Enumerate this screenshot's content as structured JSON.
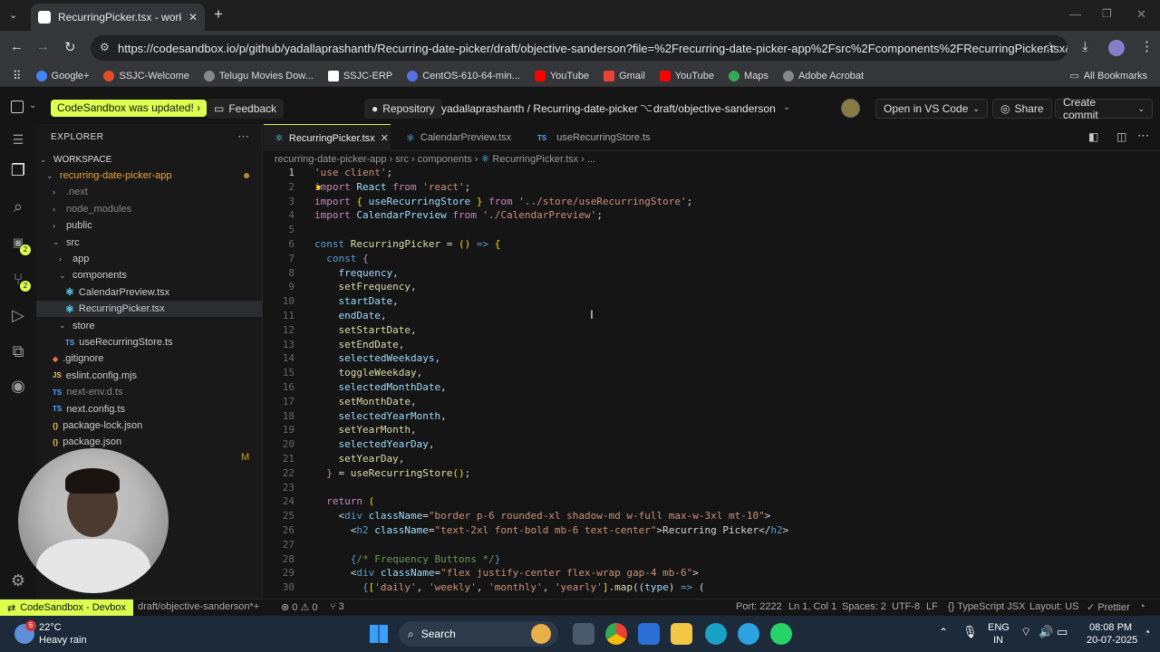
{
  "browser": {
    "tab_title": "RecurringPicker.tsx - workspace",
    "url": "https://codesandbox.io/p/github/yadallaprashanth/Recurring-date-picker/draft/objective-sanderson?file=%2Frecurring-date-picker-app%2Fsrc%2Fcomponents%2FRecurringPicker.tsx&workspace...",
    "bookmarks": [
      "Google+",
      "SSJC-Welcome",
      "Telugu Movies Dow...",
      "SSJC-ERP",
      "CentOS-610-64-min...",
      "YouTube",
      "Gmail",
      "YouTube",
      "Maps",
      "Adobe Acrobat"
    ],
    "all_bookmarks": "All Bookmarks",
    "bookmark_colors": [
      "#4285f4",
      "#e34c26",
      "#888888",
      "#ffffff",
      "#5b6ee1",
      "#ff0000",
      "#ea4335",
      "#ff0000",
      "#34a853",
      "#888888"
    ]
  },
  "topbar": {
    "update_notice": "CodeSandbox was updated!",
    "feedback": "Feedback",
    "repository": "Repository",
    "repo_path": "yadallaprashanth / Recurring-date-picker",
    "branch": "draft/objective-sanderson",
    "open_vscode": "Open in VS Code",
    "share": "Share",
    "create_commit": "Create commit"
  },
  "explorer": {
    "title": "EXPLORER",
    "workspace": "WORKSPACE",
    "items": [
      {
        "label": "recurring-date-picker-app",
        "kind": "folder-open",
        "indent": 1,
        "color": "#e8a33d",
        "dot": true
      },
      {
        "label": ".next",
        "kind": "folder",
        "indent": 2,
        "color": "#888888"
      },
      {
        "label": "node_modules",
        "kind": "folder",
        "indent": 2,
        "color": "#888888"
      },
      {
        "label": "public",
        "kind": "folder",
        "indent": 2,
        "color": "#cccccc"
      },
      {
        "label": "src",
        "kind": "folder-open",
        "indent": 2,
        "color": "#cccccc"
      },
      {
        "label": "app",
        "kind": "folder",
        "indent": 3,
        "color": "#cccccc"
      },
      {
        "label": "components",
        "kind": "folder-open",
        "indent": 3,
        "color": "#cccccc"
      },
      {
        "label": "CalendarPreview.tsx",
        "kind": "react",
        "indent": 4,
        "color": "#cccccc"
      },
      {
        "label": "RecurringPicker.tsx",
        "kind": "react",
        "indent": 4,
        "color": "#cccccc",
        "selected": true
      },
      {
        "label": "store",
        "kind": "folder-open",
        "indent": 3,
        "color": "#cccccc"
      },
      {
        "label": "useRecurringStore.ts",
        "kind": "ts",
        "indent": 4,
        "color": "#cccccc"
      },
      {
        "label": ".gitignore",
        "kind": "git",
        "indent": 2,
        "color": "#cccccc"
      },
      {
        "label": "eslint.config.mjs",
        "kind": "js",
        "indent": 2,
        "color": "#cccccc"
      },
      {
        "label": "next-env.d.ts",
        "kind": "ts",
        "indent": 2,
        "color": "#888888"
      },
      {
        "label": "next.config.ts",
        "kind": "ts",
        "indent": 2,
        "color": "#cccccc"
      },
      {
        "label": "package-lock.json",
        "kind": "json",
        "indent": 2,
        "color": "#cccccc"
      },
      {
        "label": "package.json",
        "kind": "json",
        "indent": 2,
        "color": "#cccccc"
      }
    ],
    "modified_marker": "M"
  },
  "editor": {
    "tabs": [
      {
        "label": "RecurringPicker.tsx",
        "icon": "react-icon",
        "active": true
      },
      {
        "label": "CalendarPreview.tsx",
        "icon": "react-icon",
        "active": false
      },
      {
        "label": "useRecurringStore.ts",
        "icon": "ts-icon",
        "active": false
      }
    ],
    "breadcrumb": [
      "recurring-date-picker-app",
      "src",
      "components",
      "RecurringPicker.tsx",
      "..."
    ],
    "lines": [
      {
        "n": "1",
        "html": "<span class='s'>'use client'</span><span class='p'>;</span>"
      },
      {
        "n": "2",
        "html": "<span class='k'>import</span> <span class='v'>React</span> <span class='k'>from</span> <span class='s'>'react'</span>;"
      },
      {
        "n": "3",
        "html": "<span class='k'>import</span> <span class='y'>{</span> <span class='v'>useRecurringStore</span> <span class='y'>}</span> <span class='k'>from</span> <span class='s'>'../store/useRecurringStore'</span>;"
      },
      {
        "n": "4",
        "html": "<span class='k'>import</span> <span class='v'>CalendarPreview</span> <span class='k'>from</span> <span class='s'>'./CalendarPreview'</span>;"
      },
      {
        "n": "5",
        "html": ""
      },
      {
        "n": "6",
        "html": "<span class='kb'>const</span> <span class='f'>RecurringPicker</span> = <span class='y'>()</span> <span class='kb'>=&gt;</span> <span class='y'>{</span>"
      },
      {
        "n": "7",
        "html": "  <span class='kb'>const</span> <span class='k'>{</span>"
      },
      {
        "n": "8",
        "html": "    <span class='v'>frequency</span>,"
      },
      {
        "n": "9",
        "html": "    <span class='f'>setFrequency</span>,"
      },
      {
        "n": "10",
        "html": "    <span class='v'>startDate</span>,"
      },
      {
        "n": "11",
        "html": "    <span class='v'>endDate</span>,"
      },
      {
        "n": "12",
        "html": "    <span class='f'>setStartDate</span>,"
      },
      {
        "n": "13",
        "html": "    <span class='f'>setEndDate</span>,"
      },
      {
        "n": "14",
        "html": "    <span class='v'>selectedWeekdays</span>,"
      },
      {
        "n": "15",
        "html": "    <span class='f'>toggleWeekday</span>,"
      },
      {
        "n": "16",
        "html": "    <span class='v'>selectedMonthDate</span>,"
      },
      {
        "n": "17",
        "html": "    <span class='f'>setMonthDate</span>,"
      },
      {
        "n": "18",
        "html": "    <span class='v'>selectedYearMonth</span>,"
      },
      {
        "n": "19",
        "html": "    <span class='f'>setYearMonth</span>,"
      },
      {
        "n": "20",
        "html": "    <span class='v'>selectedYearDay</span>,"
      },
      {
        "n": "21",
        "html": "    <span class='f'>setYearDay</span>,"
      },
      {
        "n": "22",
        "html": "  <span class='k'>}</span> = <span class='f'>useRecurringStore</span><span class='y'>()</span>;"
      },
      {
        "n": "23",
        "html": ""
      },
      {
        "n": "24",
        "html": "  <span class='k'>return</span> <span class='y'>(</span>"
      },
      {
        "n": "25",
        "html": "    <span class='p'>&lt;</span><span class='kb'>div</span> <span class='v'>className</span>=<span class='s'>\"border p-6 rounded-xl shadow-md w-full max-w-3xl mt-10\"</span><span class='p'>&gt;</span>"
      },
      {
        "n": "26",
        "html": "      <span class='p'>&lt;</span><span class='kb'>h2</span> <span class='v'>className</span>=<span class='s'>\"text-2xl font-bold mb-6 text-center\"</span><span class='p'>&gt;</span>Recurring Picker<span class='p'>&lt;/</span><span class='kb'>h2</span><span class='p'>&gt;</span>"
      },
      {
        "n": "27",
        "html": ""
      },
      {
        "n": "28",
        "html": "      <span class='kb'>{</span><span class='c'>/* Frequency Buttons */</span><span class='kb'>}</span>"
      },
      {
        "n": "29",
        "html": "      <span class='p'>&lt;</span><span class='kb'>div</span> <span class='v'>className</span>=<span class='s'>\"flex justify-center flex-wrap gap-4 mb-6\"</span><span class='p'>&gt;</span>"
      },
      {
        "n": "30",
        "html": "        <span class='kb'>{</span><span class='y'>[</span><span class='s'>'daily'</span>, <span class='s'>'weekly'</span>, <span class='s'>'monthly'</span>, <span class='s'>'yearly'</span><span class='y'>]</span>.<span class='f'>map</span>((<span class='v'>type</span>) <span class='kb'>=&gt;</span> ("
      }
    ]
  },
  "statusbar": {
    "devbox": "CodeSandbox - Devbox",
    "branch": "draft/objective-sanderson*+",
    "errors": "⊗ 0 ⚠ 0",
    "ports": "⑂ 3",
    "port": "Port: 2222",
    "position": "Ln 1, Col 1",
    "spaces": "Spaces: 2",
    "encoding": "UTF-8",
    "eol": "LF",
    "language": "{} TypeScript JSX",
    "layout": "Layout: US",
    "prettier": "✓ Prettier"
  },
  "taskbar": {
    "weather_temp": "22°C",
    "weather_desc": "Heavy rain",
    "weather_badge": "6",
    "search": "Search",
    "lang": "ENG",
    "region": "IN",
    "time": "08:08 PM",
    "date": "20-07-2025"
  }
}
